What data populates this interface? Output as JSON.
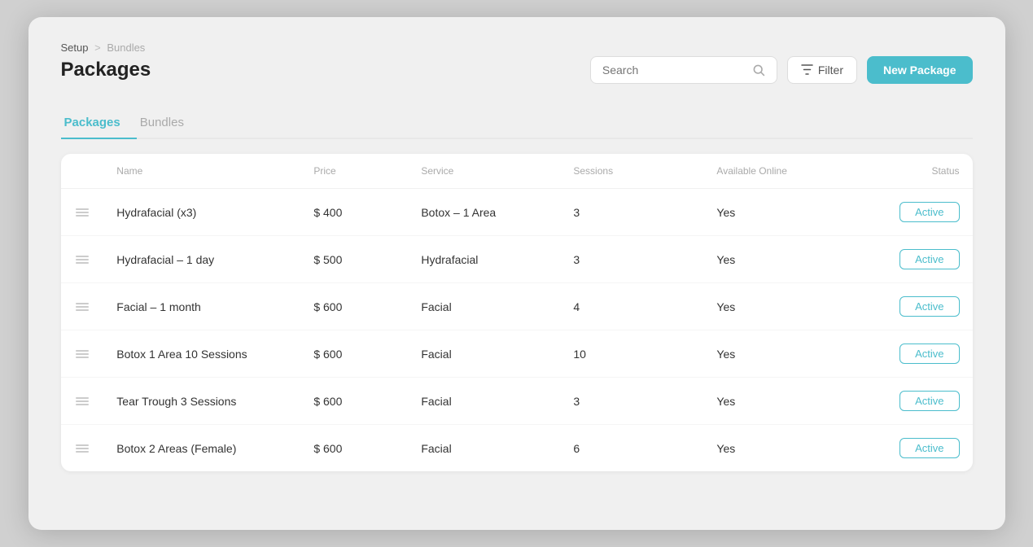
{
  "breadcrumb": {
    "setup": "Setup",
    "separator": ">",
    "current": "Bundles"
  },
  "page": {
    "title": "Packages"
  },
  "search": {
    "placeholder": "Search"
  },
  "buttons": {
    "filter": "Filter",
    "new_package": "New Package"
  },
  "tabs": [
    {
      "id": "packages",
      "label": "Packages",
      "active": true
    },
    {
      "id": "bundles",
      "label": "Bundles",
      "active": false
    }
  ],
  "table": {
    "columns": [
      {
        "id": "drag",
        "label": ""
      },
      {
        "id": "name",
        "label": "Name"
      },
      {
        "id": "price",
        "label": "Price"
      },
      {
        "id": "service",
        "label": "Service"
      },
      {
        "id": "sessions",
        "label": "Sessions"
      },
      {
        "id": "available_online",
        "label": "Available Online"
      },
      {
        "id": "status",
        "label": "Status"
      }
    ],
    "rows": [
      {
        "name": "Hydrafacial (x3)",
        "price": "$ 400",
        "service": "Botox – 1 Area",
        "sessions": "3",
        "available_online": "Yes",
        "status": "Active"
      },
      {
        "name": "Hydrafacial – 1 day",
        "price": "$ 500",
        "service": "Hydrafacial",
        "sessions": "3",
        "available_online": "Yes",
        "status": "Active"
      },
      {
        "name": "Facial – 1 month",
        "price": "$ 600",
        "service": "Facial",
        "sessions": "4",
        "available_online": "Yes",
        "status": "Active"
      },
      {
        "name": "Botox 1 Area 10 Sessions",
        "price": "$ 600",
        "service": "Facial",
        "sessions": "10",
        "available_online": "Yes",
        "status": "Active"
      },
      {
        "name": "Tear Trough 3 Sessions",
        "price": "$ 600",
        "service": "Facial",
        "sessions": "3",
        "available_online": "Yes",
        "status": "Active"
      },
      {
        "name": "Botox 2 Areas (Female)",
        "price": "$ 600",
        "service": "Facial",
        "sessions": "6",
        "available_online": "Yes",
        "status": "Active"
      }
    ]
  }
}
